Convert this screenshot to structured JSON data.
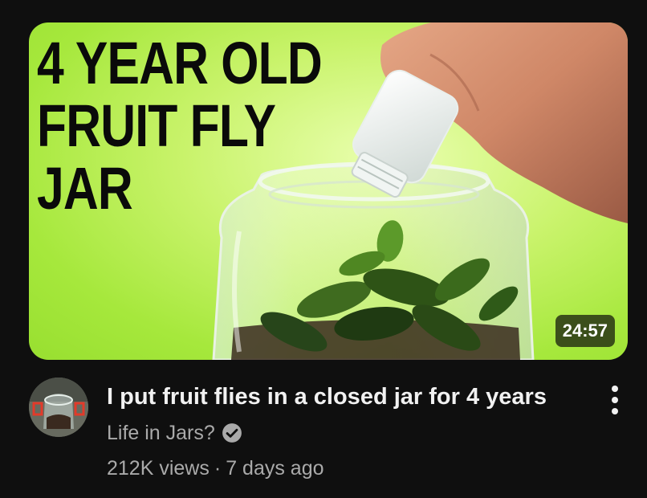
{
  "thumbnail": {
    "title_lines": [
      "4 YEAR OLD",
      "FRUIT FLY",
      "JAR"
    ],
    "duration": "24:57",
    "background_color": "#a6e83c"
  },
  "video": {
    "title": "I put fruit flies in a closed jar for 4 years",
    "channel": "Life in Jars?",
    "channel_verified_icon": "verified-check-icon",
    "views": "212K views",
    "separator": "·",
    "age": "7 days ago"
  },
  "menu": {
    "icon": "more-vertical-icon"
  }
}
